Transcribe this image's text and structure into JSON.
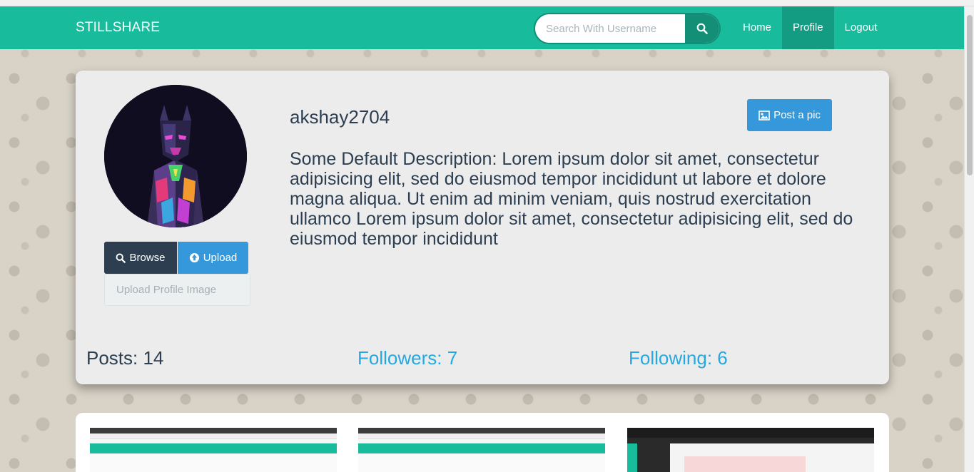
{
  "app": {
    "brand": "STILLSHARE"
  },
  "search": {
    "placeholder": "Search With Username",
    "icon": "search-icon"
  },
  "nav": {
    "items": [
      {
        "label": "Home",
        "active": false
      },
      {
        "label": "Profile",
        "active": true
      },
      {
        "label": "Logout",
        "active": false
      }
    ]
  },
  "profile": {
    "username": "akshay2704",
    "description": "Some Default Description: Lorem ipsum dolor sit amet, consectetur adipisicing elit, sed do eiusmod tempor incididunt ut labore et dolore magna aliqua. Ut enim ad minim veniam, quis nostrud exercitation ullamco Lorem ipsum dolor sit amet, consectetur adipisicing elit, sed do eiusmod tempor incididunt",
    "browse_label": "Browse",
    "upload_label": "Upload",
    "file_placeholder": "Upload Profile Image",
    "post_label": "Post a pic",
    "stats": {
      "posts": "Posts: 14",
      "followers": "Followers: 7",
      "following": "Following: 6"
    }
  },
  "colors": {
    "navbar": "#18bc9c",
    "primary_dark": "#2c3e50",
    "primary_blue": "#3498db",
    "link": "#25a8e0"
  }
}
